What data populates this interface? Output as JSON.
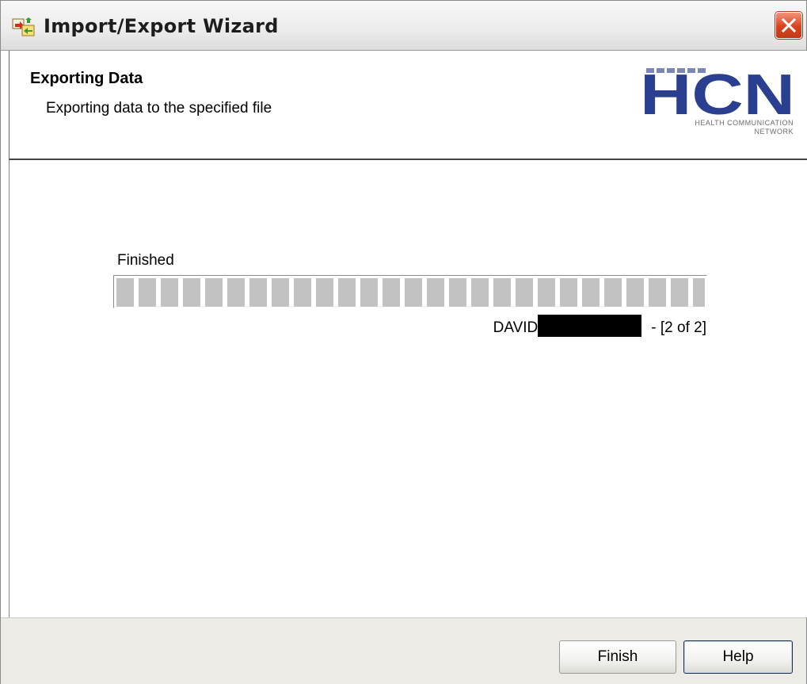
{
  "window": {
    "title": "Import/Export Wizard",
    "close_icon": "close-x-icon",
    "app_icon": "import-export-icon",
    "close_color": "#d9431d"
  },
  "header": {
    "title": "Exporting Data",
    "subtitle": "Exporting data to the specified file",
    "logo": {
      "mark": "HCN",
      "line1": "HEALTH COMMUNICATION",
      "line2": "NETWORK",
      "color": "#2a3f8f"
    }
  },
  "progress": {
    "status": "Finished",
    "fraction": 1.0,
    "record_name": "DAVID",
    "record_count": "- [2 of 2]"
  },
  "footer": {
    "finish_label": "Finish",
    "help_label": "Help"
  }
}
